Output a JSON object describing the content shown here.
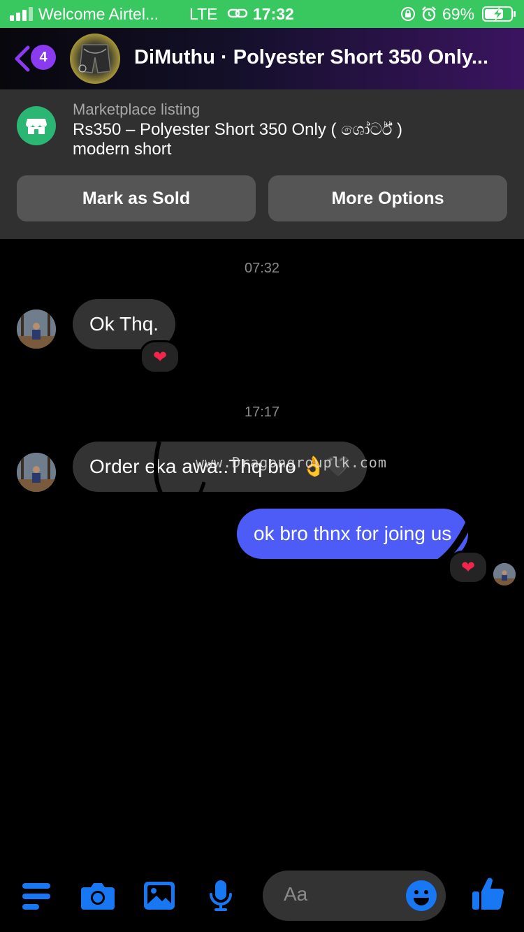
{
  "status_bar": {
    "carrier": "Welcome Airtel...",
    "network": "LTE",
    "time": "17:32",
    "battery_percent": "69%",
    "signal_bars": 3
  },
  "header": {
    "unread_count": "4",
    "title": "DiMuthu · Polyester Short 350 Only..."
  },
  "listing": {
    "label": "Marketplace listing",
    "line1": "Rs350 – Polyester Short 350 Only ( ශෝර්ට් )",
    "line2": "modern short",
    "mark_sold_label": "Mark as Sold",
    "more_options_label": "More Options"
  },
  "messages": {
    "timestamp1": "07:32",
    "msg1": "Ok Thq.",
    "msg1_reaction": "❤",
    "timestamp2": "17:17",
    "msg2": "Order eka awa..Thq bro 👌🖤",
    "msg3": "ok bro thnx for joing us",
    "msg3_reaction": "❤"
  },
  "watermark": "www.Dragongrouplk.com",
  "composer": {
    "placeholder": "Aa"
  },
  "colors": {
    "status_bar": "#39c760",
    "accent_blue": "#1877f2",
    "outgoing_bubble": "#4d5cf6",
    "incoming_bubble": "#333333",
    "badge": "#8a3bf0",
    "store_icon": "#2bb673"
  }
}
